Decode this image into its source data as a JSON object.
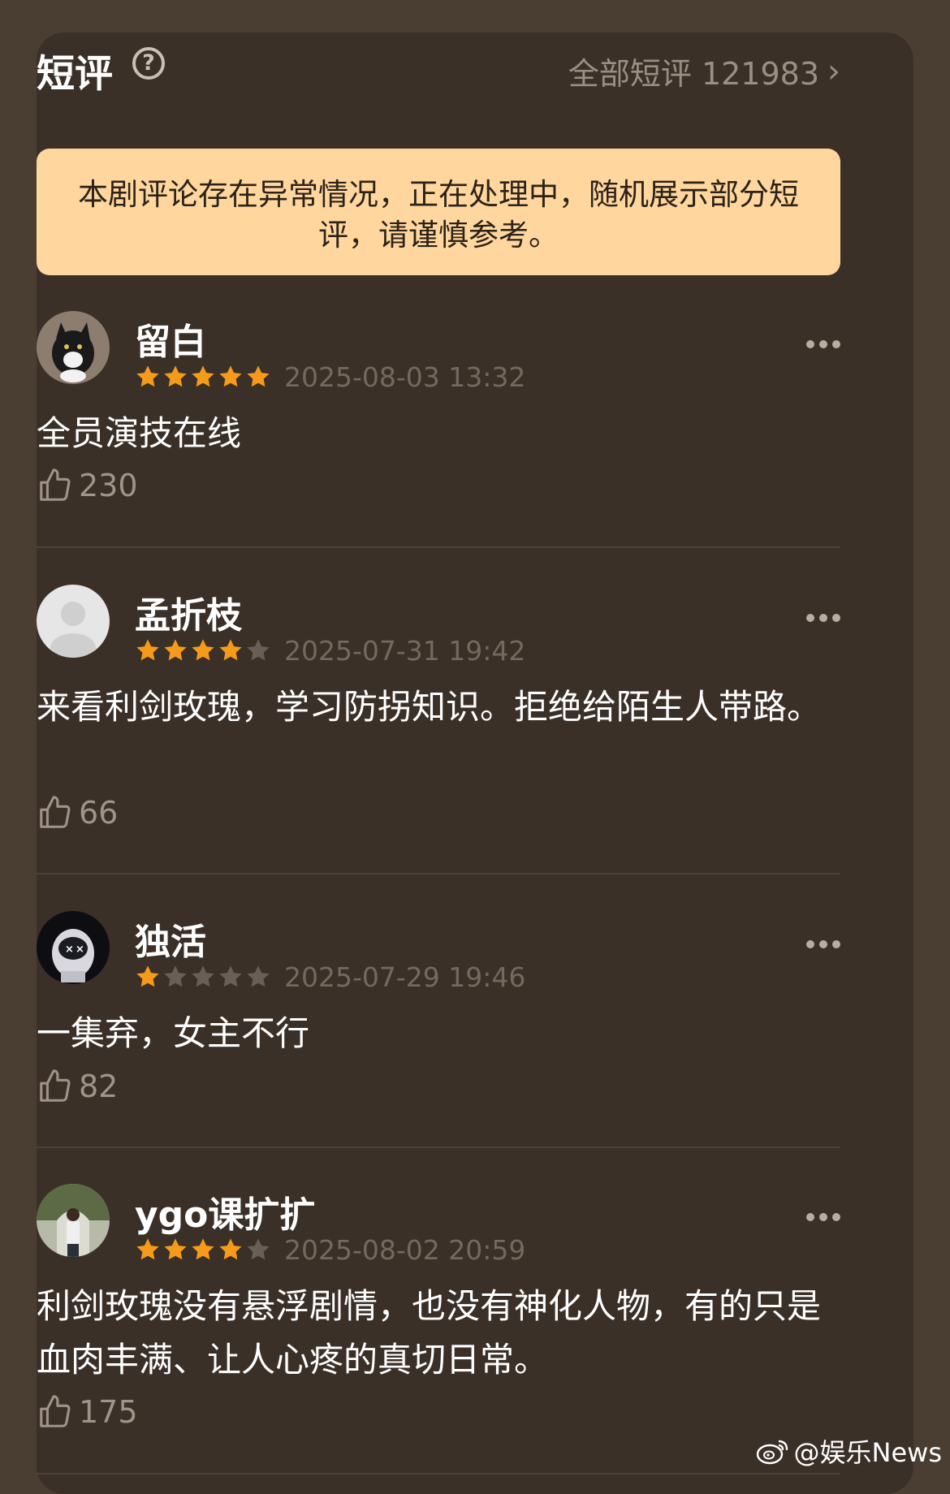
{
  "header": {
    "title": "短评",
    "all_reviews_label": "全部短评 121983"
  },
  "notice": {
    "text": "本剧评论存在异常情况，正在处理中，随机展示部分短评，请谨慎参考。"
  },
  "reviews": [
    {
      "name": "留白",
      "rating": 5,
      "time": "2025-08-03 13:32",
      "content": "全员演技在线",
      "likes": "230",
      "avatar": "cat-avatar"
    },
    {
      "name": "孟折枝",
      "rating": 4,
      "time": "2025-07-31 19:42",
      "content": "来看利剑玫瑰，学习防拐知识。拒绝给陌生人带路。",
      "likes": "66",
      "avatar": "default-avatar"
    },
    {
      "name": "独活",
      "rating": 1,
      "time": "2025-07-29 19:46",
      "content": "一集弃，女主不行",
      "likes": "82",
      "avatar": "astronaut-avatar"
    },
    {
      "name": "ygo课扩扩",
      "rating": 4,
      "time": "2025-08-02 20:59",
      "content": "利剑玫瑰没有悬浮剧情，也没有神化人物，有的只是血肉丰满、让人心疼的真切日常。",
      "likes": "175",
      "avatar": "photo-avatar"
    }
  ],
  "watermark": {
    "text": "@娱乐News"
  },
  "colors": {
    "page_bg": "#4a3e33",
    "card_bg": "#3b3028",
    "notice_bg": "#ffd79e",
    "star_filled": "#f59a1a",
    "star_empty": "#6a5f55"
  }
}
